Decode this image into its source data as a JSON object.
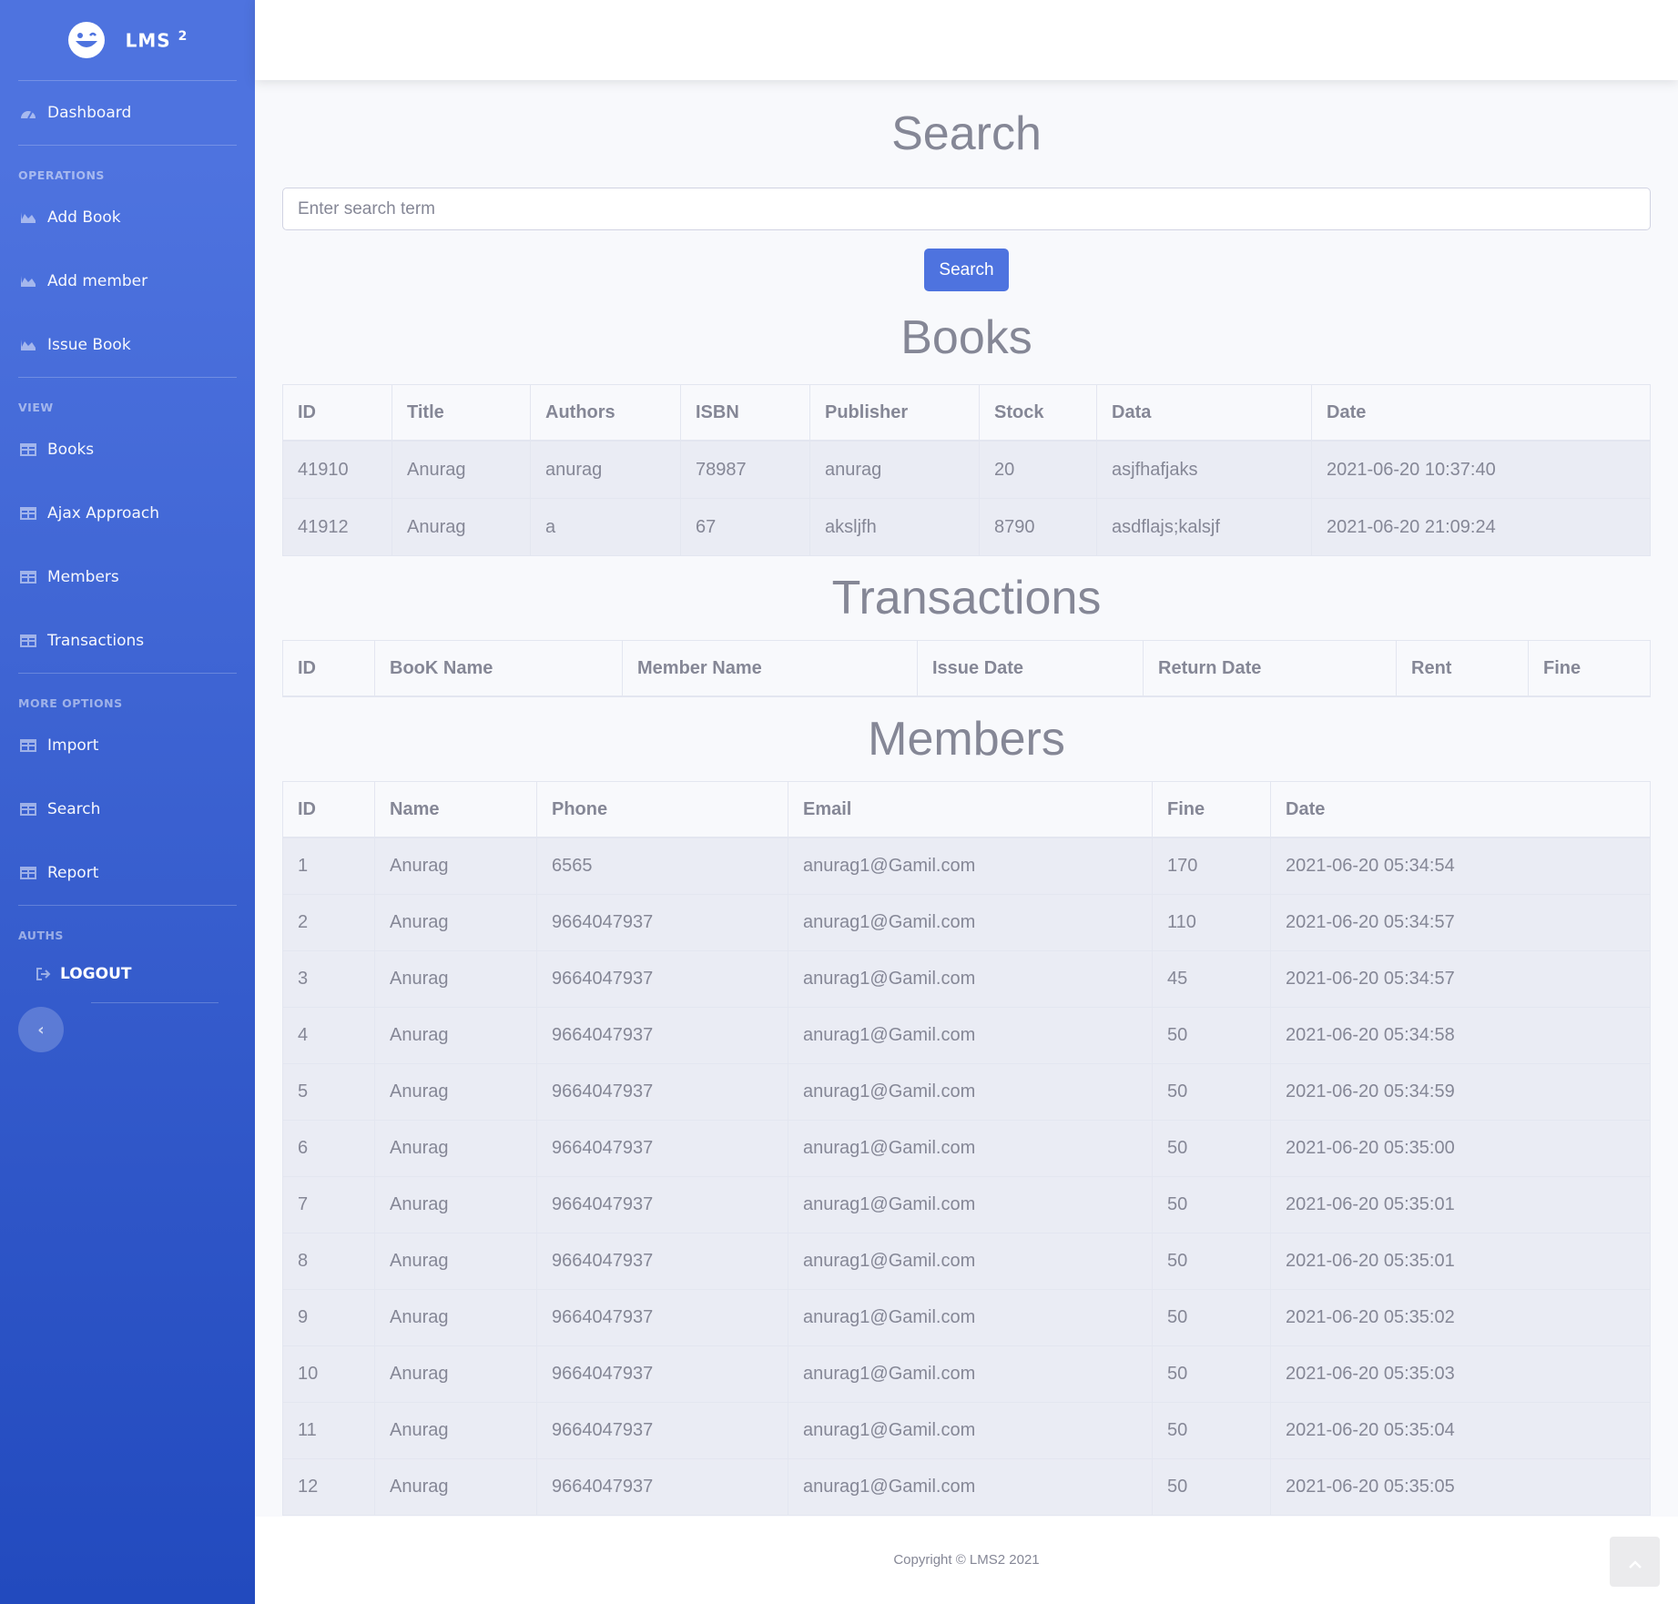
{
  "brand": {
    "name": "LMS",
    "sup": "2"
  },
  "sidebar": {
    "dashboard": "Dashboard",
    "headings": {
      "operations": "OPERATIONS",
      "view": "VIEW",
      "more": "MORE OPTIONS",
      "auths": "AUTHS"
    },
    "operations": [
      "Add Book",
      "Add member",
      "Issue Book"
    ],
    "view": [
      "Books",
      "Ajax Approach",
      "Members",
      "Transactions"
    ],
    "more": [
      "Import",
      "Search",
      "Report"
    ],
    "logout": "LOGOUT",
    "toggle": "‹"
  },
  "search": {
    "title": "Search",
    "placeholder": "Enter search term",
    "button": "Search"
  },
  "books": {
    "title": "Books",
    "headers": [
      "ID",
      "Title",
      "Authors",
      "ISBN",
      "Publisher",
      "Stock",
      "Data",
      "Date"
    ],
    "rows": [
      [
        "41910",
        "Anurag",
        "anurag",
        "78987",
        "anurag",
        "20",
        "asjfhafjaks",
        "2021-06-20 10:37:40"
      ],
      [
        "41912",
        "Anurag",
        "a",
        "67",
        "aksljfh",
        "8790",
        "asdflajs;kalsjf",
        "2021-06-20 21:09:24"
      ]
    ]
  },
  "transactions": {
    "title": "Transactions",
    "headers": [
      "ID",
      "BooK Name",
      "Member Name",
      "Issue Date",
      "Return Date",
      "Rent",
      "Fine"
    ]
  },
  "members": {
    "title": "Members",
    "headers": [
      "ID",
      "Name",
      "Phone",
      "Email",
      "Fine",
      "Date"
    ],
    "rows": [
      [
        "1",
        "Anurag",
        "6565",
        "anurag1@Gamil.com",
        "170",
        "2021-06-20 05:34:54"
      ],
      [
        "2",
        "Anurag",
        "9664047937",
        "anurag1@Gamil.com",
        "110",
        "2021-06-20 05:34:57"
      ],
      [
        "3",
        "Anurag",
        "9664047937",
        "anurag1@Gamil.com",
        "45",
        "2021-06-20 05:34:57"
      ],
      [
        "4",
        "Anurag",
        "9664047937",
        "anurag1@Gamil.com",
        "50",
        "2021-06-20 05:34:58"
      ],
      [
        "5",
        "Anurag",
        "9664047937",
        "anurag1@Gamil.com",
        "50",
        "2021-06-20 05:34:59"
      ],
      [
        "6",
        "Anurag",
        "9664047937",
        "anurag1@Gamil.com",
        "50",
        "2021-06-20 05:35:00"
      ],
      [
        "7",
        "Anurag",
        "9664047937",
        "anurag1@Gamil.com",
        "50",
        "2021-06-20 05:35:01"
      ],
      [
        "8",
        "Anurag",
        "9664047937",
        "anurag1@Gamil.com",
        "50",
        "2021-06-20 05:35:01"
      ],
      [
        "9",
        "Anurag",
        "9664047937",
        "anurag1@Gamil.com",
        "50",
        "2021-06-20 05:35:02"
      ],
      [
        "10",
        "Anurag",
        "9664047937",
        "anurag1@Gamil.com",
        "50",
        "2021-06-20 05:35:03"
      ],
      [
        "11",
        "Anurag",
        "9664047937",
        "anurag1@Gamil.com",
        "50",
        "2021-06-20 05:35:04"
      ],
      [
        "12",
        "Anurag",
        "9664047937",
        "anurag1@Gamil.com",
        "50",
        "2021-06-20 05:35:05"
      ]
    ]
  },
  "footer": {
    "text": "Copyright © LMS2 2021"
  },
  "colors": {
    "primary": "#4e73df",
    "primary_dark": "#224abe",
    "text": "#858796",
    "row_bg": "#eaecf4"
  },
  "icons": {
    "brand": "laugh-wink-icon",
    "dashboard": "tachometer-icon",
    "operations": "chart-area-icon",
    "view": "table-icon",
    "logout": "sign-out-icon",
    "scroll_top": "angle-up-icon"
  }
}
